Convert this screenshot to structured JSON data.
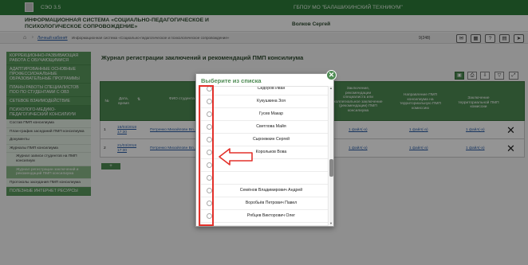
{
  "colors": {
    "brand": "#2e7d3a",
    "accent": "#4f8c54",
    "annotation": "#e3312b",
    "link": "#2a5ea8"
  },
  "header": {
    "version": "СЭО 3.5",
    "org": "ГБПОУ МО \"БАЛАШИХИНСКИЙ ТЕХНИКУМ\"",
    "system_title": "ИНФОРМАЦИОННАЯ СИСТЕМА «СОЦИАЛЬНО-ПЕДАГОГИЧЕСКОЕ И ПСИХОЛОГИЧЕСКОЕ СОПРОВОЖДЕНИЕ»",
    "user_name": "Волков Сергей"
  },
  "breadcrumbs": {
    "home_icon": "home-icon",
    "items": [
      "Личный кабинет",
      "Информационная система «Социально-педагогическое и психологическое сопровождение»"
    ],
    "counter": "9(248)"
  },
  "toolbar_icons": [
    "mail-icon",
    "calendar-icon",
    "question-icon",
    "document-icon",
    "exit-icon"
  ],
  "sidebar": {
    "items": [
      {
        "label": "КОРРЕКЦИОННО-РАЗВИВАЮЩАЯ РАБОТА С ОБУЧАЮЩИМИСЯ",
        "kind": "section"
      },
      {
        "label": "АДАПТИРОВАННЫЕ ОСНОВНЫЕ ПРОФЕССИОНАЛЬНЫЕ ОБРАЗОВАТЕЛЬНЫЕ ПРОГРАММЫ",
        "kind": "section"
      },
      {
        "label": "ПЛАНЫ РАБОТЫ СПЕЦИАЛИСТОВ ПОО ПО СТУДЕНТАМИ С ОВЗ",
        "kind": "section"
      },
      {
        "label": "СЕТЕВОЕ ВЗАИМОДЕЙСТВИЕ",
        "kind": "section"
      },
      {
        "label": "ПСИХОЛОГО-МЕДИКО-ПЕДАГОГИЧЕСКИЙ КОНСИЛИУМ",
        "kind": "section"
      },
      {
        "label": "Состав ПМП консилиума",
        "kind": "sub"
      },
      {
        "label": "План-график заседаний ПМП консилиума",
        "kind": "sub"
      },
      {
        "label": "Документы",
        "kind": "sub"
      },
      {
        "label": "Журналы ПМП консилиума",
        "kind": "sub"
      },
      {
        "label": "Журнал записи студентов на ПМП консилиум",
        "kind": "indent"
      },
      {
        "label": "Журнал регистрации заключений и рекомендаций ПМП консилиума",
        "kind": "active"
      },
      {
        "label": "Протоколы заседания ПМП консилиума",
        "kind": "sub"
      },
      {
        "label": "ПОЛЕЗНЫЕ ИНТЕРНЕТ РЕСУРСЫ",
        "kind": "section"
      }
    ]
  },
  "main": {
    "title": "Журнал регистрации заключений и рекомендаций ПМП консилиума",
    "table": {
      "headers": {
        "num": "№",
        "date": "Дата, время",
        "fio": "ФИО студента",
        "conclusion": "Заключение, рекомендации специалиста или коллегиальное заключение (рекомендации) ПМП консилиума",
        "direction": "Направление ПМП консилиума на территориальную ПМП комиссию",
        "territorial": "Заключение территориальной ПМП комиссии"
      },
      "rows": [
        {
          "num": "1",
          "date": "19/03/2018 17:30",
          "fio": "Петренко Михайловн Вл...",
          "conclusion": "1 файл(-а)",
          "direction": "1 файл(-а)",
          "territorial": "1 файл(-а)"
        },
        {
          "num": "2",
          "date": "21/03/2018 17:30",
          "fio": "Петренко Михайловн Вл...",
          "conclusion": "1 файл(-а)",
          "direction": "1 файл(-а)",
          "territorial": "1 файл(-а)"
        }
      ],
      "add_label": "+"
    }
  },
  "modal": {
    "title": "Выберите из списка",
    "close_icon": "close-icon",
    "items": [
      "Сидоров Иван",
      "Кукушкина Зоя",
      "Гусев Макар",
      "Светлова Майя",
      "Сыроежкин Сергей",
      "Корольков Вова",
      "",
      "",
      "Семёнов Владимирович Андрей",
      "Воробьёв Петрович Павел",
      "Рябцев Викторович Олег"
    ]
  }
}
